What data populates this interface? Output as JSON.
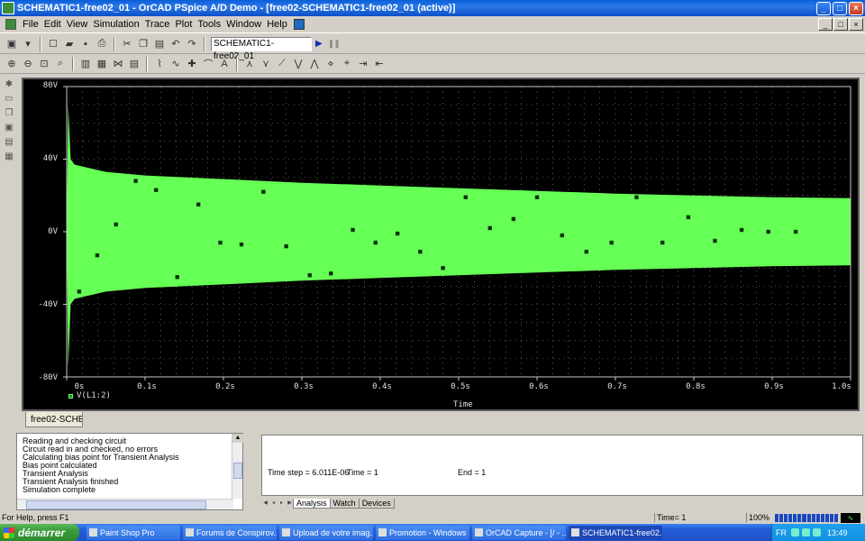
{
  "window": {
    "title": "SCHEMATIC1-free02_01 - OrCAD PSpice A/D Demo  - [free02-SCHEMATIC1-free02_01 (active)]",
    "buttons": [
      "_",
      "□",
      "×"
    ]
  },
  "menu": {
    "items": [
      "File",
      "Edit",
      "View",
      "Simulation",
      "Trace",
      "Plot",
      "Tools",
      "Window",
      "Help"
    ],
    "mdi_buttons": [
      "_",
      "□",
      "×"
    ]
  },
  "toolbar": {
    "simulation_profile": "SCHEMATIC1-free02_01",
    "run_glyph": "▶",
    "pause_glyph": "❚❚"
  },
  "icons": {
    "new": "new-file-icon",
    "open": "open-folder-icon",
    "save": "save-icon",
    "print": "print-icon",
    "cut": "cut-icon",
    "copy": "copy-icon",
    "paste": "paste-icon",
    "undo": "undo-icon",
    "redo": "redo-icon",
    "zoom_in": "zoom-in-icon",
    "zoom_out": "zoom-out-icon",
    "zoom_area": "zoom-area-icon",
    "zoom_fit": "zoom-fit-icon"
  },
  "plot": {
    "tab_label": "free02-SCHE...",
    "legend_trace": "V(L1:2)",
    "trace_color": "#66ff55",
    "background_color": "#000000",
    "grid": true
  },
  "chart_data": {
    "type": "area",
    "title": "",
    "xlabel": "Time",
    "ylabel": "",
    "xlim": [
      0,
      1.0
    ],
    "ylim": [
      -80,
      80
    ],
    "x_ticks": [
      "0s",
      "0.1s",
      "0.2s",
      "0.3s",
      "0.4s",
      "0.5s",
      "0.6s",
      "0.7s",
      "0.8s",
      "0.9s",
      "1.0s"
    ],
    "y_ticks": [
      "80V",
      "40V",
      "0V",
      "-40V",
      "-80V"
    ],
    "series": [
      {
        "name": "V(L1:2)",
        "x": [
          0.0,
          0.002,
          0.005,
          0.01,
          0.02,
          0.05,
          0.1,
          0.2,
          0.3,
          0.4,
          0.5,
          0.6,
          0.7,
          0.8,
          0.9,
          1.0
        ],
        "upper": [
          0,
          70,
          40,
          37,
          36,
          33,
          31,
          29,
          27,
          25.5,
          24,
          22.5,
          21,
          20,
          19,
          18.5
        ],
        "lower": [
          0,
          -75,
          -40,
          -37,
          -36,
          -33,
          -31,
          -29,
          -27,
          -25.5,
          -24,
          -22.5,
          -21,
          -20,
          -19,
          -18.5
        ]
      }
    ],
    "markers": {
      "x": [
        0.016,
        0.039,
        0.063,
        0.088,
        0.114,
        0.141,
        0.168,
        0.196,
        0.223,
        0.251,
        0.28,
        0.31,
        0.337,
        0.365,
        0.394,
        0.422,
        0.451,
        0.48,
        0.509,
        0.54,
        0.57,
        0.6,
        0.632,
        0.663,
        0.695,
        0.727,
        0.76,
        0.793,
        0.827,
        0.861,
        0.895,
        0.93
      ],
      "y": [
        -33,
        -13,
        4,
        28,
        23,
        -25,
        15,
        -6,
        -7,
        22,
        -8,
        -24,
        -23,
        1,
        -6,
        -1,
        -11,
        -20,
        19,
        2,
        7,
        19,
        -2,
        -11,
        -6,
        19,
        -6,
        8,
        -5,
        1,
        0,
        0
      ]
    }
  },
  "output_log": [
    "Reading and checking circuit",
    "Circuit read in and checked, no errors",
    "Calculating bias point for Transient Analysis",
    "Bias point calculated",
    "Transient Analysis",
    "Transient Analysis finished",
    "Simulation complete"
  ],
  "sim_status": {
    "time_step": "Time step =  6.011E-06",
    "time": "Time =  1",
    "end": "End =  1"
  },
  "bottom_tabs": [
    "Analysis",
    "Watch",
    "Devices"
  ],
  "statusbar": {
    "help": "For Help, press F1",
    "time": "Time= 1",
    "zoom": "100%",
    "progress": 1.0
  },
  "taskbar": {
    "start": "démarrer",
    "tasks": [
      "Paint Shop Pro",
      "Forums de Conspirov...",
      "Upload de votre imag...",
      "Promotion - Windows ...",
      "OrCAD Capture - [/ - ...",
      "SCHEMATIC1-free02..."
    ],
    "lang": "FR",
    "clock": "13:49"
  }
}
